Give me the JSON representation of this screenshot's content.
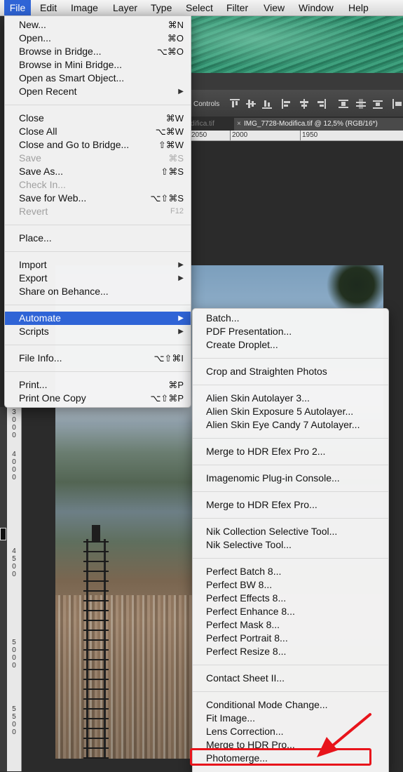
{
  "menubar": {
    "items": [
      "File",
      "Edit",
      "Image",
      "Layer",
      "Type",
      "Select",
      "Filter",
      "View",
      "Window",
      "Help"
    ]
  },
  "options_bar": {
    "controls_label": "Controls"
  },
  "document_tabs": {
    "inactive_tab": "difica.tif",
    "active_tab": "IMG_7728-Modifica.tif @ 12,5% (RGB/16*)",
    "close_glyph": "×"
  },
  "ruler_top": {
    "labels": [
      "2050",
      "2000",
      "1950"
    ]
  },
  "ruler_left": {
    "labels": [
      "3",
      "0",
      "0",
      "0",
      "4",
      "0",
      "0",
      "0",
      "4",
      "5",
      "0",
      "0",
      "5",
      "0",
      "0",
      "0",
      "5",
      "5",
      "0",
      "0"
    ]
  },
  "file_menu": {
    "items": [
      {
        "label": "New...",
        "shortcut": "⌘N"
      },
      {
        "label": "Open...",
        "shortcut": "⌘O"
      },
      {
        "label": "Browse in Bridge...",
        "shortcut": "⌥⌘O"
      },
      {
        "label": "Browse in Mini Bridge...",
        "shortcut": ""
      },
      {
        "label": "Open as Smart Object...",
        "shortcut": ""
      },
      {
        "label": "Open Recent",
        "shortcut": "",
        "submenu": true
      },
      {
        "label": "Close",
        "shortcut": "⌘W"
      },
      {
        "label": "Close All",
        "shortcut": "⌥⌘W"
      },
      {
        "label": "Close and Go to Bridge...",
        "shortcut": "⇧⌘W"
      },
      {
        "label": "Save",
        "shortcut": "⌘S",
        "disabled": true
      },
      {
        "label": "Save As...",
        "shortcut": "⇧⌘S"
      },
      {
        "label": "Check In...",
        "shortcut": "",
        "disabled": true
      },
      {
        "label": "Save for Web...",
        "shortcut": "⌥⇧⌘S"
      },
      {
        "label": "Revert",
        "shortcut": "F12",
        "disabled": true
      },
      {
        "label": "Place...",
        "shortcut": ""
      },
      {
        "label": "Import",
        "shortcut": "",
        "submenu": true
      },
      {
        "label": "Export",
        "shortcut": "",
        "submenu": true
      },
      {
        "label": "Share on Behance...",
        "shortcut": ""
      },
      {
        "label": "Automate",
        "shortcut": "",
        "submenu": true,
        "highlighted": true
      },
      {
        "label": "Scripts",
        "shortcut": "",
        "submenu": true
      },
      {
        "label": "File Info...",
        "shortcut": "⌥⇧⌘I"
      },
      {
        "label": "Print...",
        "shortcut": "⌘P"
      },
      {
        "label": "Print One Copy",
        "shortcut": "⌥⇧⌘P"
      }
    ],
    "submenu_arrow": "▶"
  },
  "automate_menu": {
    "items": [
      "Batch...",
      "PDF Presentation...",
      "Create Droplet...",
      "Crop and Straighten Photos",
      "Alien Skin Autolayer 3...",
      "Alien Skin Exposure 5 Autolayer...",
      "Alien Skin Eye Candy 7 Autolayer...",
      "Merge to HDR Efex Pro 2...",
      "Imagenomic Plug-in Console...",
      "Merge to HDR Efex Pro...",
      "Nik Collection Selective Tool...",
      "Nik Selective Tool...",
      "Perfect Batch 8...",
      "Perfect BW 8...",
      "Perfect Effects 8...",
      "Perfect Enhance 8...",
      "Perfect Mask 8...",
      "Perfect Portrait 8...",
      "Perfect Resize 8...",
      "Contact Sheet II...",
      "Conditional Mode Change...",
      "Fit Image...",
      "Lens Correction...",
      "Merge to HDR Pro...",
      "Photomerge..."
    ]
  },
  "colors": {
    "menu_highlight": "#2f64d6",
    "annotation_red": "#e8141b",
    "menu_background": "#f4f4f4"
  }
}
